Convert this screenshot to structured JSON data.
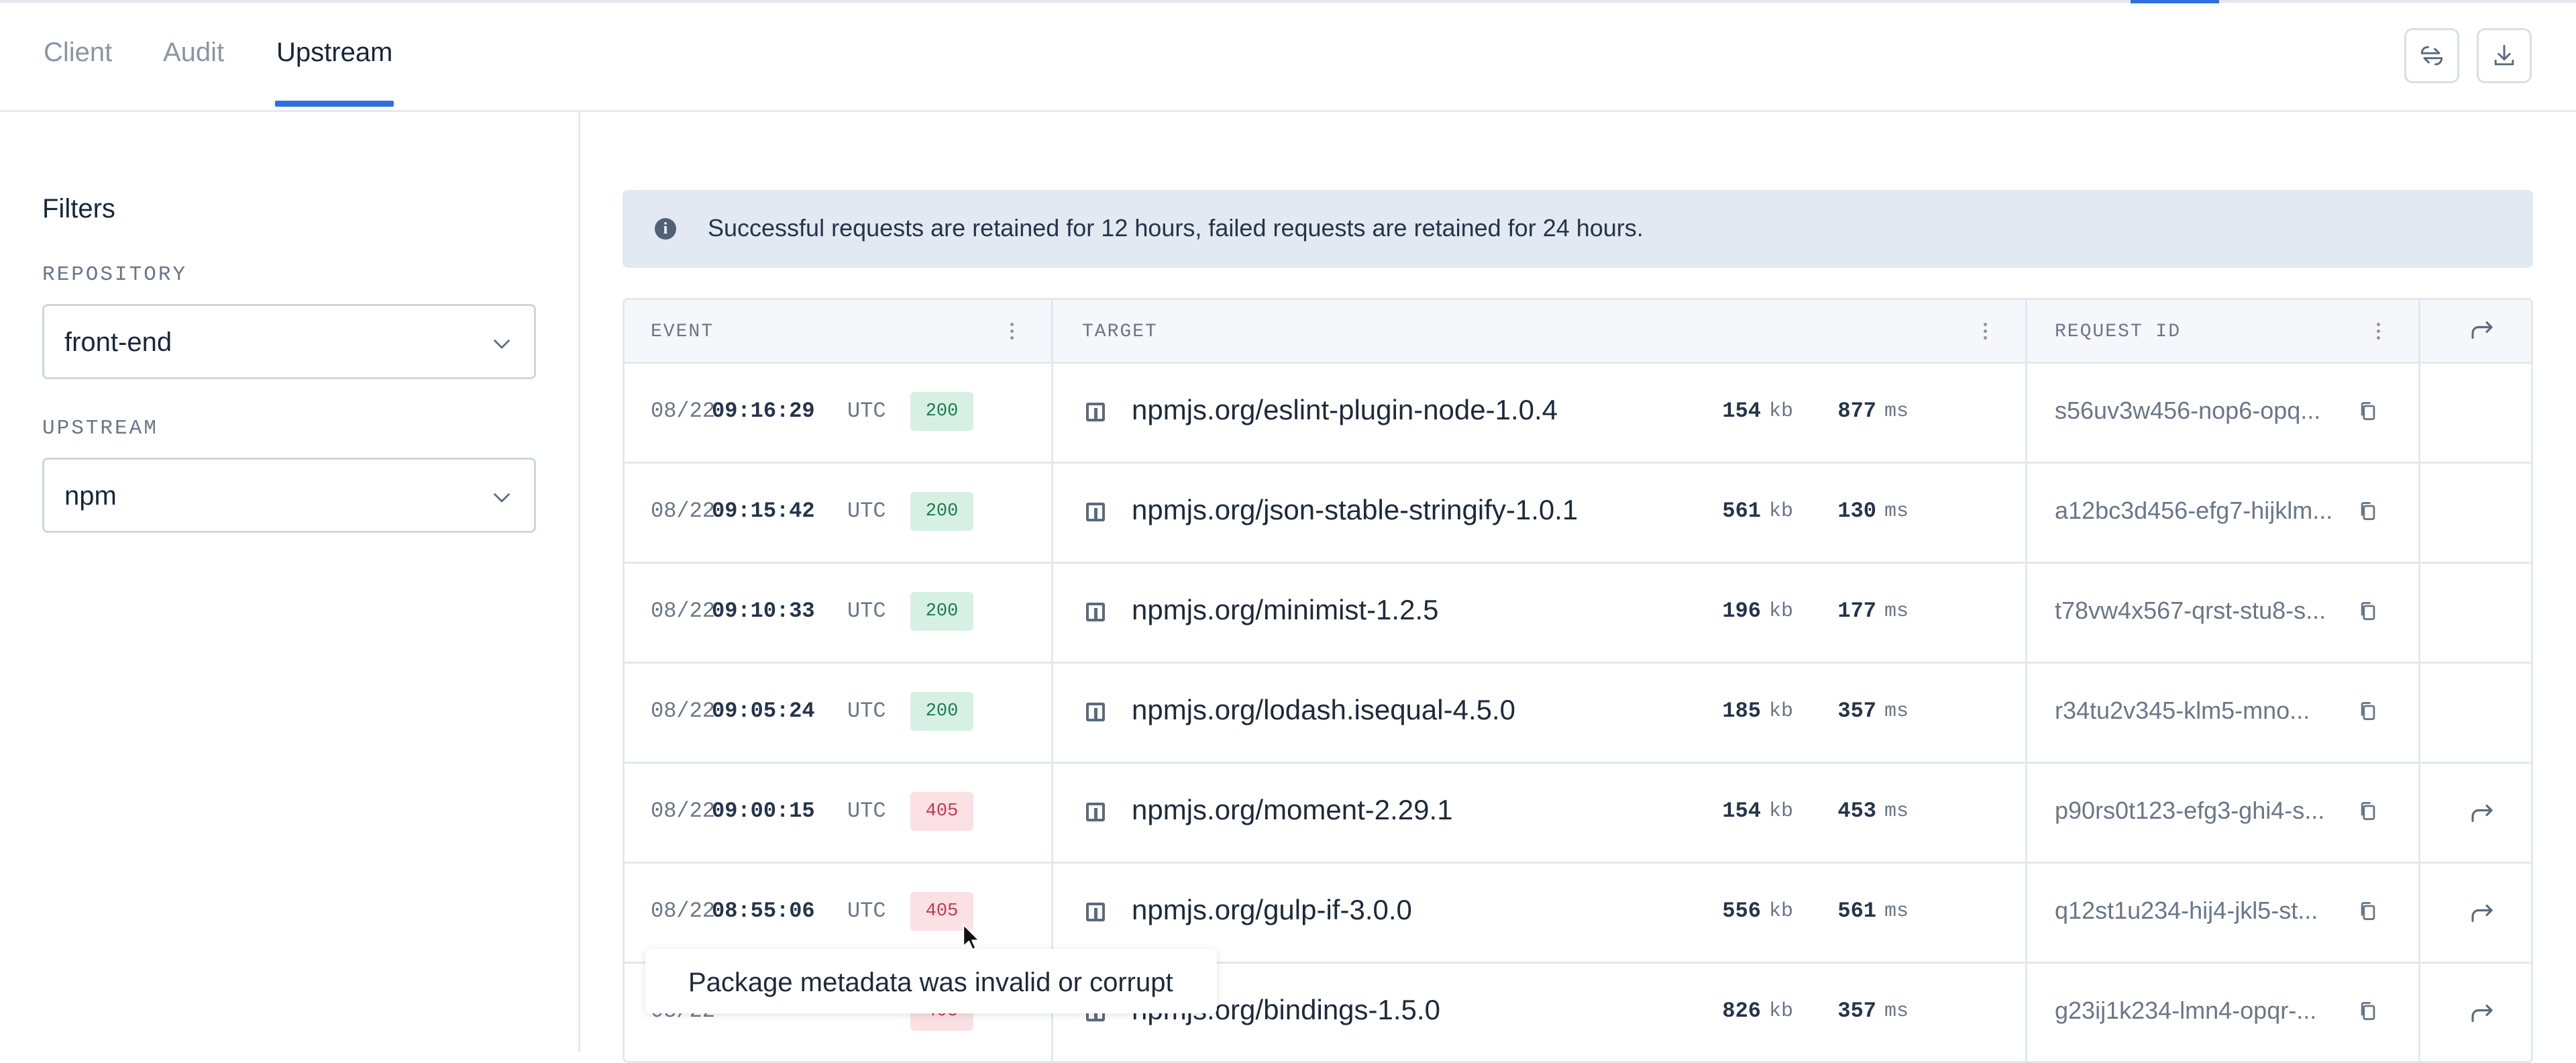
{
  "tabs": [
    {
      "label": "Client",
      "active": false
    },
    {
      "label": "Audit",
      "active": false
    },
    {
      "label": "Upstream",
      "active": true
    }
  ],
  "header_actions": {
    "sync": "sync-icon",
    "download": "download-icon"
  },
  "filters": {
    "title": "Filters",
    "repository": {
      "label": "REPOSITORY",
      "value": "front-end"
    },
    "upstream": {
      "label": "UPSTREAM",
      "value": "npm"
    }
  },
  "banner": {
    "icon": "info-icon",
    "text": "Successful requests are retained for 12 hours, failed requests are retained for 24 hours."
  },
  "table": {
    "columns": {
      "event": "EVENT",
      "target": "TARGET",
      "request_id": "REQUEST ID"
    },
    "rows": [
      {
        "date": "08/22",
        "time": "09:16:29",
        "tz": "UTC",
        "status": "200",
        "target": "npmjs.org/eslint-plugin-node-1.0.4",
        "size": "154",
        "size_unit": "kb",
        "duration": "877",
        "duration_unit": "ms",
        "request_id": "s56uv3w456-nop6-opq...",
        "replay": false
      },
      {
        "date": "08/22",
        "time": "09:15:42",
        "tz": "UTC",
        "status": "200",
        "target": "npmjs.org/json-stable-stringify-1.0.1",
        "size": "561",
        "size_unit": "kb",
        "duration": "130",
        "duration_unit": "ms",
        "request_id": "a12bc3d456-efg7-hijklm...",
        "replay": false
      },
      {
        "date": "08/22",
        "time": "09:10:33",
        "tz": "UTC",
        "status": "200",
        "target": "npmjs.org/minimist-1.2.5",
        "size": "196",
        "size_unit": "kb",
        "duration": "177",
        "duration_unit": "ms",
        "request_id": "t78vw4x567-qrst-stu8-s...",
        "replay": false
      },
      {
        "date": "08/22",
        "time": "09:05:24",
        "tz": "UTC",
        "status": "200",
        "target": "npmjs.org/lodash.isequal-4.5.0",
        "size": "185",
        "size_unit": "kb",
        "duration": "357",
        "duration_unit": "ms",
        "request_id": "r34tu2v345-klm5-mno...",
        "replay": false
      },
      {
        "date": "08/22",
        "time": "09:00:15",
        "tz": "UTC",
        "status": "405",
        "target": "npmjs.org/moment-2.29.1",
        "size": "154",
        "size_unit": "kb",
        "duration": "453",
        "duration_unit": "ms",
        "request_id": "p90rs0t123-efg3-ghi4-s...",
        "replay": true
      },
      {
        "date": "08/22",
        "time": "08:55:06",
        "tz": "UTC",
        "status": "405",
        "target": "npmjs.org/gulp-if-3.0.0",
        "size": "556",
        "size_unit": "kb",
        "duration": "561",
        "duration_unit": "ms",
        "request_id": "q12st1u234-hij4-jkl5-st...",
        "replay": true
      },
      {
        "date": "08/22",
        "time": "",
        "tz": "",
        "status": "405",
        "target": "npmjs.org/bindings-1.5.0",
        "size": "826",
        "size_unit": "kb",
        "duration": "357",
        "duration_unit": "ms",
        "request_id": "g23ij1k234-lmn4-opqr-...",
        "replay": true
      }
    ]
  },
  "tooltip": {
    "text": "Package metadata was invalid or corrupt"
  },
  "colors": {
    "accent": "#2f6fe0",
    "ok_bg": "#d6f1e4",
    "ok_fg": "#1f7a4e",
    "err_bg": "#fbe0e4",
    "err_fg": "#c0394f"
  }
}
